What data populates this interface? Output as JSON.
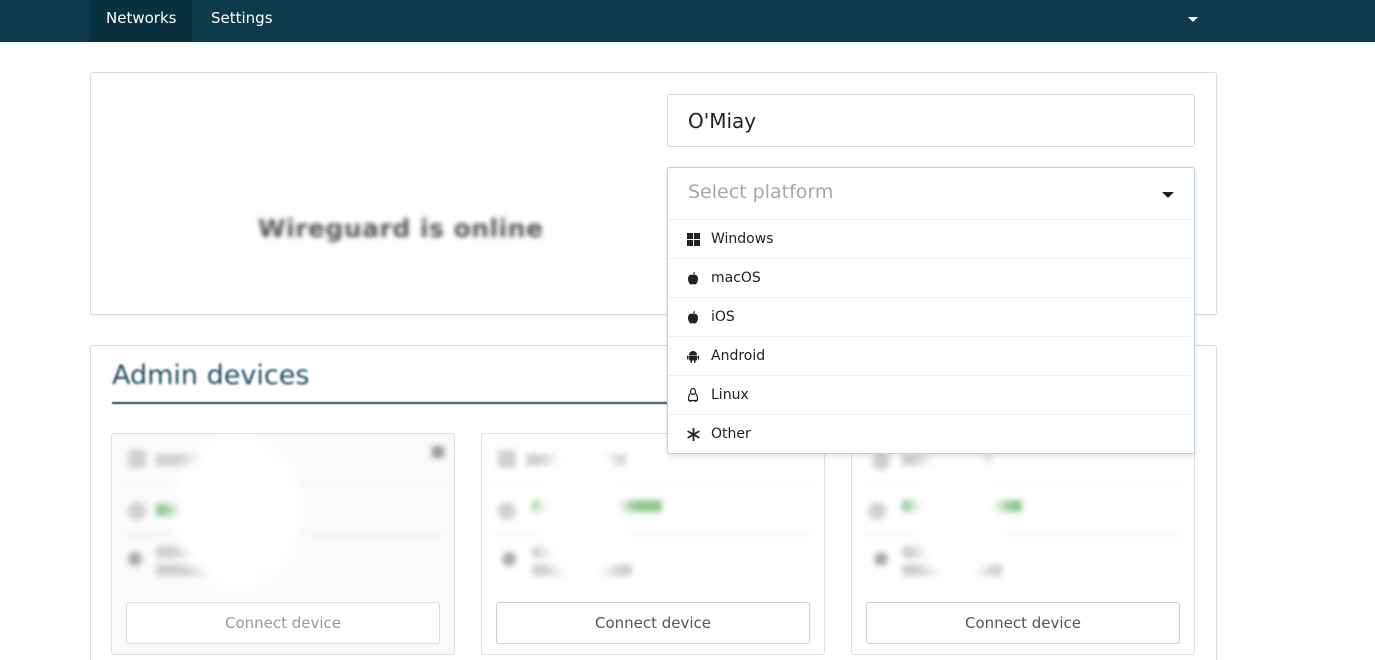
{
  "nav": {
    "tabs": [
      {
        "label": "Networks",
        "active": true
      },
      {
        "label": "Settings",
        "active": false
      }
    ]
  },
  "status": {
    "text": "Wireguard is online"
  },
  "form": {
    "name_value": "O'Miay",
    "platform_placeholder": "Select platform",
    "platform_options": [
      {
        "label": "Windows",
        "icon": "windows-icon"
      },
      {
        "label": "macOS",
        "icon": "apple-icon"
      },
      {
        "label": "iOS",
        "icon": "apple-icon"
      },
      {
        "label": "Android",
        "icon": "android-icon"
      },
      {
        "label": "Linux",
        "icon": "linux-icon"
      },
      {
        "label": "Other",
        "icon": "asterisk-icon"
      }
    ]
  },
  "admin": {
    "title": "Admin devices",
    "devices": [
      {
        "connect_label": "Connect device",
        "disabled": true
      },
      {
        "connect_label": "Connect device",
        "disabled": false
      },
      {
        "connect_label": "Connect device",
        "disabled": false
      }
    ]
  },
  "colors": {
    "topbar": "#0e3b4c",
    "accent": "#1f4e63",
    "status_green": "#8fc88f"
  }
}
